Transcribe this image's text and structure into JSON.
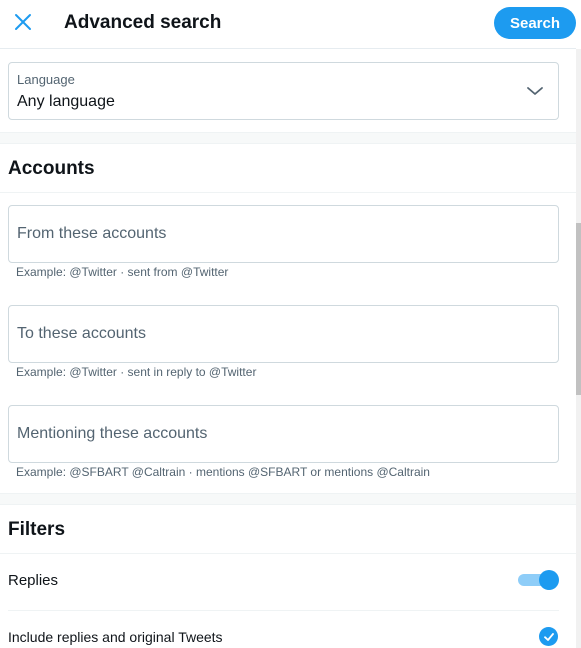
{
  "header": {
    "title": "Advanced search",
    "search_label": "Search",
    "close_icon": "close-icon"
  },
  "language": {
    "label": "Language",
    "value": "Any language"
  },
  "accounts": {
    "title": "Accounts",
    "fields": [
      {
        "placeholder": "From these accounts",
        "value": "",
        "hint": "Example: @Twitter · sent from @Twitter"
      },
      {
        "placeholder": "To these accounts",
        "value": "",
        "hint": "Example: @Twitter · sent in reply to @Twitter"
      },
      {
        "placeholder": "Mentioning these accounts",
        "value": "",
        "hint": "Example: @SFBART @Caltrain · mentions @SFBART or mentions @Caltrain"
      }
    ]
  },
  "filters": {
    "title": "Filters",
    "replies_label": "Replies",
    "replies_enabled": true,
    "include_label": "Include replies and original Tweets",
    "include_checked": true
  },
  "colors": {
    "accent": "#1d9bf0",
    "toggle_track": "#8ecdf8",
    "border": "#cfd9de",
    "secondary_text": "#536471"
  }
}
